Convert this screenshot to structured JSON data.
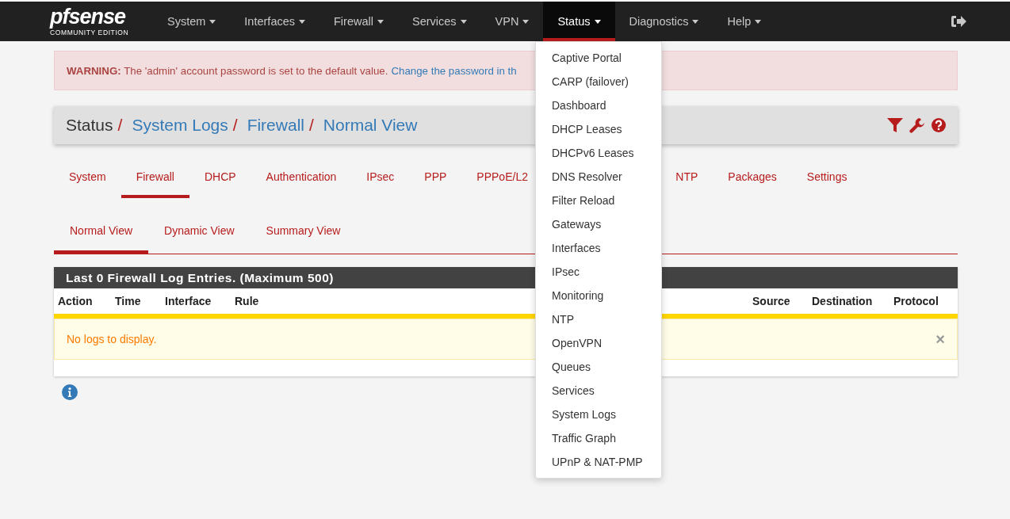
{
  "logo": {
    "name": "pfsense",
    "subtitle": "COMMUNITY EDITION"
  },
  "nav": [
    {
      "label": "System",
      "selected": false
    },
    {
      "label": "Interfaces",
      "selected": false
    },
    {
      "label": "Firewall",
      "selected": false
    },
    {
      "label": "Services",
      "selected": false
    },
    {
      "label": "VPN",
      "selected": false
    },
    {
      "label": "Status",
      "selected": true
    },
    {
      "label": "Diagnostics",
      "selected": false
    },
    {
      "label": "Help",
      "selected": false
    }
  ],
  "status_menu": [
    "Captive Portal",
    "CARP (failover)",
    "Dashboard",
    "DHCP Leases",
    "DHCPv6 Leases",
    "DNS Resolver",
    "Filter Reload",
    "Gateways",
    "Interfaces",
    "IPsec",
    "Monitoring",
    "NTP",
    "OpenVPN",
    "Queues",
    "Services",
    "System Logs",
    "Traffic Graph",
    "UPnP & NAT-PMP"
  ],
  "warning": {
    "label": "WARNING:",
    "text": "The 'admin' account password is set to the default value.",
    "link": "Change the password in th"
  },
  "breadcrumb": [
    {
      "label": "Status",
      "link": false,
      "separator": "/"
    },
    {
      "label": "System Logs",
      "link": true,
      "separator": "/"
    },
    {
      "label": "Firewall",
      "link": true,
      "separator": "/"
    },
    {
      "label": "Normal View",
      "link": true
    }
  ],
  "tabs": [
    {
      "label": "System",
      "selected": false
    },
    {
      "label": "Firewall",
      "selected": true
    },
    {
      "label": "DHCP",
      "selected": false
    },
    {
      "label": "Authentication",
      "selected": false
    },
    {
      "label": "IPsec",
      "selected": false
    },
    {
      "label": "PPP",
      "selected": false
    },
    {
      "label": "PPPoE/L2",
      "selected": false
    },
    {
      "label": "NTP",
      "selected": false
    },
    {
      "label": "Packages",
      "selected": false
    },
    {
      "label": "Settings",
      "selected": false
    }
  ],
  "subtabs": [
    {
      "label": "Normal View",
      "selected": true
    },
    {
      "label": "Dynamic View",
      "selected": false
    },
    {
      "label": "Summary View",
      "selected": false
    }
  ],
  "table": {
    "title": "Last 0 Firewall Log Entries. (Maximum 500)",
    "columns": [
      "Action",
      "Time",
      "Interface",
      "Rule",
      "Source",
      "Destination",
      "Protocol"
    ],
    "empty_message": "No logs to display.",
    "close": "×"
  }
}
